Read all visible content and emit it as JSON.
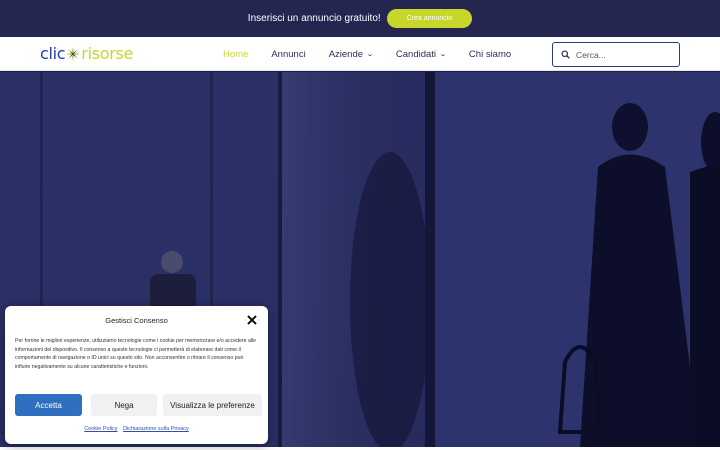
{
  "promo": {
    "text": "Inserisci un annuncio gratuito!",
    "button_label": "Crea annuncio"
  },
  "header": {
    "logo_part1": "clic",
    "logo_part2": "risorse",
    "nav": [
      {
        "label": "Home",
        "active": true
      },
      {
        "label": "Annunci"
      },
      {
        "label": "Aziende",
        "dropdown": true
      },
      {
        "label": "Candidati",
        "dropdown": true
      },
      {
        "label": "Chi siamo"
      }
    ],
    "search_placeholder": "Cerca..."
  },
  "consent": {
    "title": "Gestisci Consenso",
    "body": "Per fornire le migliori esperienze, utilizziamo tecnologie come i cookie per memorizzare e/o accedere alle informazioni del dispositivo. Il consenso a queste tecnologie ci permetterà di elaborare dati come il comportamento di navigazione o ID unici su questo sito. Non acconsentire o ritirare il consenso può influire negativamente su alcune caratteristiche e funzioni.",
    "accept_label": "Accetta",
    "deny_label": "Nega",
    "prefs_label": "Visualizza le preferenze",
    "cookie_policy": "Cookie Policy",
    "privacy": "Dichiarazione sulla Privacy"
  },
  "colors": {
    "brand_blue": "#2a3bb0",
    "brand_lime": "#c6d62b",
    "accept_blue": "#2f6fc0"
  }
}
